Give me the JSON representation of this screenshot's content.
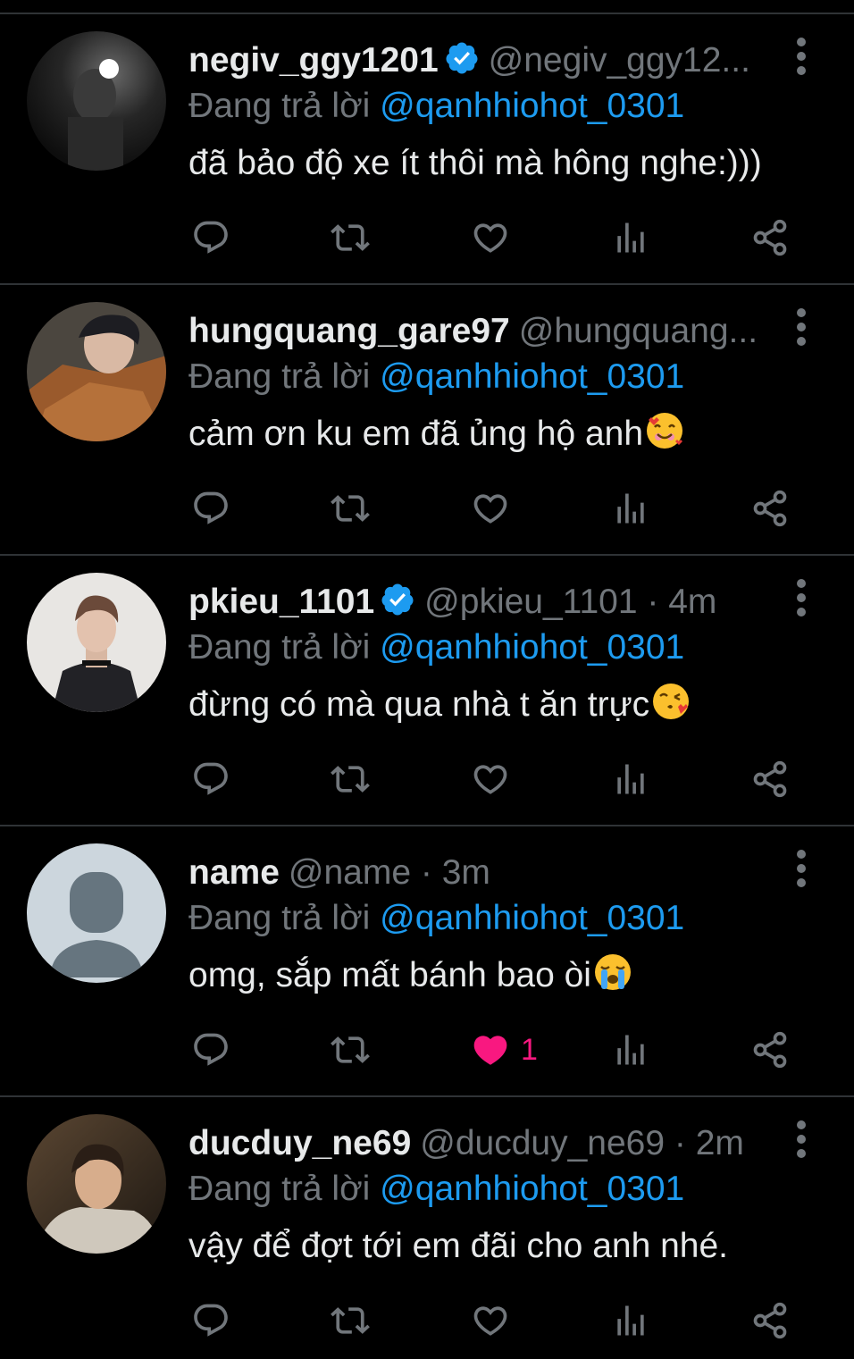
{
  "reply_prefix": "Đang trả lời",
  "colors": {
    "background": "#000000",
    "text": "#e7e9ea",
    "muted": "#71767b",
    "accent": "#1d9bf0",
    "like": "#f91880",
    "divider": "#2f3336"
  },
  "tweets": [
    {
      "name": "negiv_ggy1201",
      "verified": true,
      "handle": "@negiv_ggy12...",
      "replying_to": "@qanhhiohot_0301",
      "text": "đã bảo độ xe ít thôi mà hông nghe:)))",
      "emoji": "",
      "liked": false,
      "like_count": ""
    },
    {
      "name": "hungquang_gare97",
      "verified": false,
      "handle": "@hungquang...",
      "replying_to": "@qanhhiohot_0301",
      "text": "cảm ơn ku em đã ủng hộ anh",
      "emoji": "smiling-face-with-hearts",
      "liked": false,
      "like_count": ""
    },
    {
      "name": "pkieu_1101",
      "verified": true,
      "handle": "@pkieu_1101 · 4m",
      "replying_to": "@qanhhiohot_0301",
      "text": "đừng có mà qua nhà t ăn trực",
      "emoji": "face-blowing-kiss",
      "liked": false,
      "like_count": ""
    },
    {
      "name": "name",
      "verified": false,
      "handle": "@name · 3m",
      "replying_to": "@qanhhiohot_0301",
      "text": "omg, sắp mất bánh bao òi",
      "emoji": "loudly-crying-face",
      "liked": true,
      "like_count": "1"
    },
    {
      "name": "ducduy_ne69",
      "verified": false,
      "handle": "@ducduy_ne69 · 2m",
      "replying_to": "@qanhhiohot_0301",
      "text": "vậy để đợt tới em đãi cho anh nhé.",
      "emoji": "",
      "liked": false,
      "like_count": ""
    }
  ]
}
